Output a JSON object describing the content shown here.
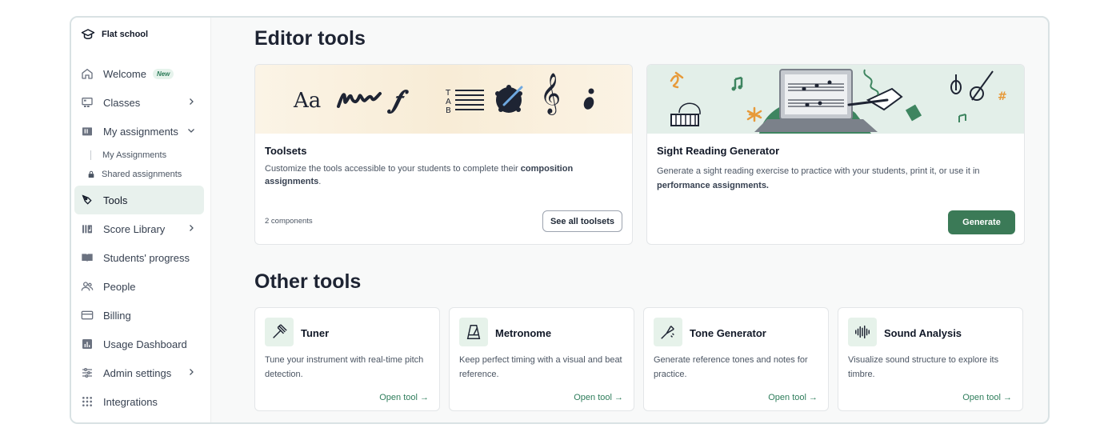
{
  "brand": {
    "name": "Flat school"
  },
  "sidebar": {
    "items": [
      {
        "label": "Welcome",
        "badge": "New"
      },
      {
        "label": "Classes"
      },
      {
        "label": "My assignments"
      },
      {
        "label": "Tools"
      },
      {
        "label": "Score Library"
      },
      {
        "label": "Students' progress"
      },
      {
        "label": "People"
      },
      {
        "label": "Billing"
      },
      {
        "label": "Usage Dashboard"
      },
      {
        "label": "Admin settings"
      },
      {
        "label": "Integrations"
      }
    ],
    "sub_items": [
      {
        "label": "My Assignments"
      },
      {
        "label": "Shared assignments"
      }
    ]
  },
  "editor_tools": {
    "heading": "Editor tools",
    "toolsets": {
      "title": "Toolsets",
      "desc_prefix": "Customize the tools accessible to your students to complete their ",
      "desc_bold": "composition assignments",
      "desc_suffix": ".",
      "count": "2 components",
      "button": "See all toolsets",
      "banner_text": "Aa"
    },
    "sight_reading": {
      "title": "Sight Reading Generator",
      "desc_prefix": "Generate a sight reading exercise to practice with your students, print it, or use it in ",
      "desc_bold": "performance assignments.",
      "button": "Generate"
    }
  },
  "other_tools": {
    "heading": "Other tools",
    "tools": [
      {
        "name": "Tuner",
        "desc": "Tune your instrument with real-time pitch detection.",
        "link": "Open tool →"
      },
      {
        "name": "Metronome",
        "desc": "Keep perfect timing with a visual and beat reference.",
        "link": "Open tool →"
      },
      {
        "name": "Tone Generator",
        "desc": "Generate reference tones and notes for practice.",
        "link": "Open tool →"
      },
      {
        "name": "Sound Analysis",
        "desc": "Visualize sound structure to explore its timbre.",
        "link": "Open tool →"
      }
    ]
  },
  "colors": {
    "accent": "#3b7a57",
    "active_bg": "#e8f1ed",
    "icon_bg": "#e6f2ea"
  }
}
